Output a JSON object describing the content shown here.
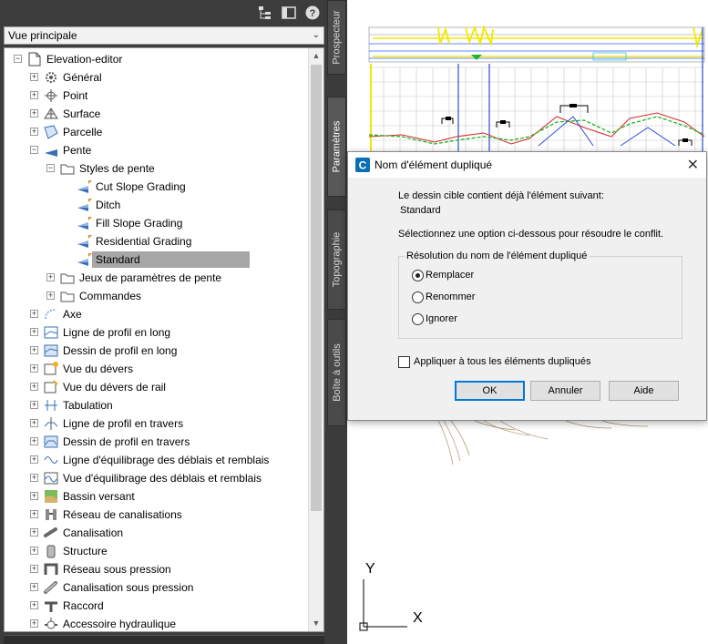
{
  "toolspace": {
    "view_selector": "Vue principale",
    "tree": {
      "root": "Elevation-editor",
      "items": [
        {
          "label": "Général",
          "icon": "gear-icon",
          "level": 1
        },
        {
          "label": "Point",
          "icon": "point-icon",
          "level": 1
        },
        {
          "label": "Surface",
          "icon": "surface-icon",
          "level": 1
        },
        {
          "label": "Parcelle",
          "icon": "parcel-icon",
          "level": 1
        },
        {
          "label": "Pente",
          "icon": "grading-icon",
          "level": 1,
          "expanded": true
        },
        {
          "label": "Styles de pente",
          "icon": "style-folder-icon",
          "level": 2,
          "expanded": true
        },
        {
          "label": "Cut Slope Grading",
          "icon": "grading-style-icon",
          "level": 3
        },
        {
          "label": "Ditch",
          "icon": "grading-style-icon",
          "level": 3
        },
        {
          "label": "Fill Slope Grading",
          "icon": "grading-style-icon",
          "level": 3
        },
        {
          "label": "Residential Grading",
          "icon": "grading-style-icon",
          "level": 3
        },
        {
          "label": "Standard",
          "icon": "grading-style-icon",
          "level": 3,
          "selected": true
        },
        {
          "label": "Jeux de paramètres de pente",
          "icon": "folder-icon",
          "level": 2
        },
        {
          "label": "Commandes",
          "icon": "folder-icon",
          "level": 2
        },
        {
          "label": "Axe",
          "icon": "alignment-icon",
          "level": 1
        },
        {
          "label": "Ligne de profil en long",
          "icon": "profile-icon",
          "level": 1
        },
        {
          "label": "Dessin de profil en long",
          "icon": "profile-view-icon",
          "level": 1
        },
        {
          "label": "Vue du dévers",
          "icon": "superelevation-icon",
          "level": 1
        },
        {
          "label": "Vue du dévers de rail",
          "icon": "cant-icon",
          "level": 1
        },
        {
          "label": "Tabulation",
          "icon": "sample-line-icon",
          "level": 1
        },
        {
          "label": "Ligne de profil en travers",
          "icon": "section-icon",
          "level": 1
        },
        {
          "label": "Dessin de profil en travers",
          "icon": "section-view-icon",
          "level": 1
        },
        {
          "label": "Ligne d'équilibrage des déblais et remblais",
          "icon": "mass-haul-icon",
          "level": 1
        },
        {
          "label": "Vue d'équilibrage des déblais et remblais",
          "icon": "mass-haul-view-icon",
          "level": 1
        },
        {
          "label": "Bassin versant",
          "icon": "catchment-icon",
          "level": 1
        },
        {
          "label": "Réseau de canalisations",
          "icon": "pipe-network-icon",
          "level": 1
        },
        {
          "label": "Canalisation",
          "icon": "pipe-icon",
          "level": 1
        },
        {
          "label": "Structure",
          "icon": "structure-icon",
          "level": 1
        },
        {
          "label": "Réseau sous pression",
          "icon": "pressure-network-icon",
          "level": 1
        },
        {
          "label": "Canalisation sous pression",
          "icon": "pressure-pipe-icon",
          "level": 1
        },
        {
          "label": "Raccord",
          "icon": "fitting-icon",
          "level": 1
        },
        {
          "label": "Accessoire hydraulique",
          "icon": "appurtenance-icon",
          "level": 1
        }
      ]
    }
  },
  "vertical_tabs": [
    "Prospecteur",
    "Paramètres",
    "Topographie",
    "Boîte à outils"
  ],
  "dialog": {
    "title": "Nom d'élément dupliqué",
    "message_line1": "Le dessin cible contient déjà l'élément suivant:",
    "item_name": "Standard",
    "instruction": "Sélectionnez une option ci-dessous pour résoudre le conflit.",
    "group_label": "Résolution du nom de l'élément dupliqué",
    "options": [
      {
        "label": "Remplacer",
        "selected": true
      },
      {
        "label": "Renommer",
        "selected": false
      },
      {
        "label": "Ignorer",
        "selected": false
      }
    ],
    "apply_all_label": "Appliquer à tous les éléments dupliqués",
    "apply_all_checked": false,
    "buttons": {
      "ok": "OK",
      "cancel": "Annuler",
      "help": "Aide"
    }
  },
  "drawing": {
    "ucs_x": "X",
    "ucs_y": "Y"
  }
}
